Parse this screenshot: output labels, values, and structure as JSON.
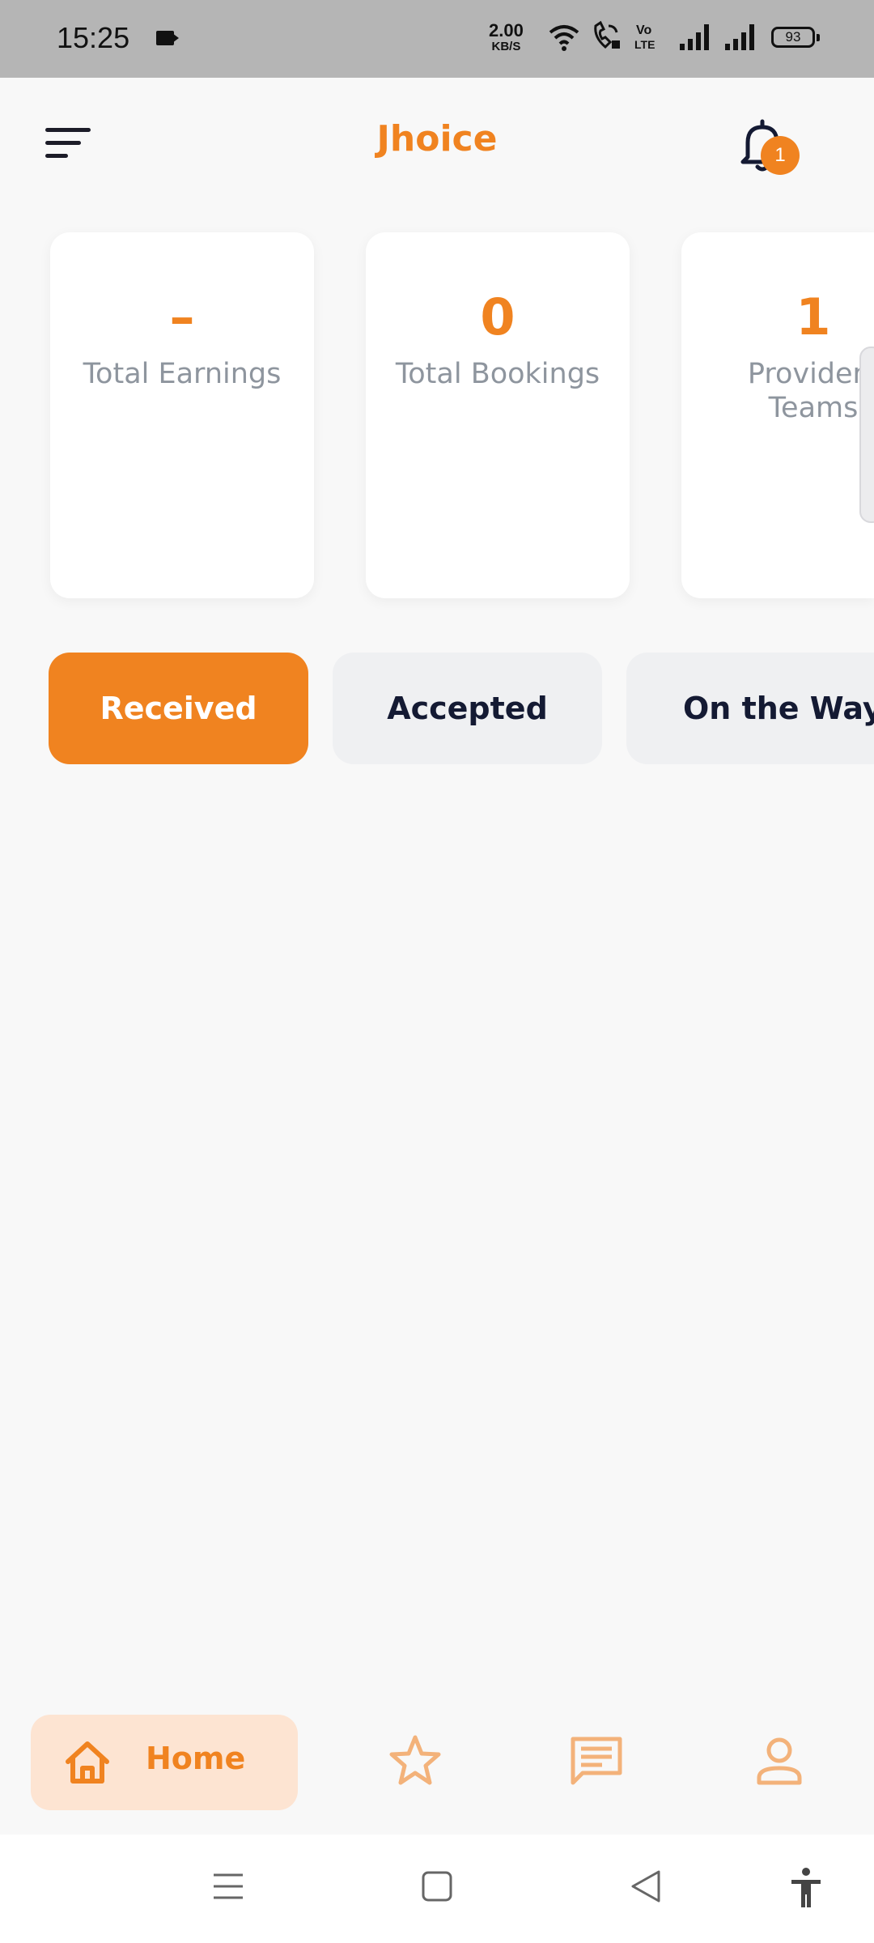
{
  "status_bar": {
    "time": "15:25",
    "net_speed_value": "2.00",
    "net_speed_unit": "KB/S",
    "battery": "93",
    "icons": [
      "video-camera-icon",
      "wifi-icon",
      "wifi-calling-icon",
      "volte-icon",
      "signal-icon",
      "signal-icon-2",
      "battery-icon"
    ]
  },
  "header": {
    "title": "Jhoice",
    "notification_count": "1",
    "menu_icon": "menu-icon",
    "bell_icon": "bell-icon"
  },
  "stats": [
    {
      "value": "–",
      "label": "Total Earnings"
    },
    {
      "value": "0",
      "label": "Total Bookings"
    },
    {
      "value": "1",
      "label": "Providers Teams"
    }
  ],
  "tabs": [
    {
      "label": "Received",
      "active": true
    },
    {
      "label": "Accepted",
      "active": false
    },
    {
      "label": "On the Way",
      "active": false
    }
  ],
  "bottom_nav": {
    "home_label": "Home",
    "icons": [
      "home-icon",
      "star-icon",
      "chat-icon",
      "profile-icon"
    ]
  },
  "system_nav": {
    "icons": [
      "recents-icon",
      "home-square-icon",
      "back-icon",
      "accessibility-icon"
    ]
  },
  "colors": {
    "accent": "#f08320",
    "accent_light": "#fde4d2",
    "dark_text": "#141a33",
    "muted_text": "#8e959e",
    "tab_inactive_bg": "#eff0f2",
    "background": "#f8f8f8"
  }
}
